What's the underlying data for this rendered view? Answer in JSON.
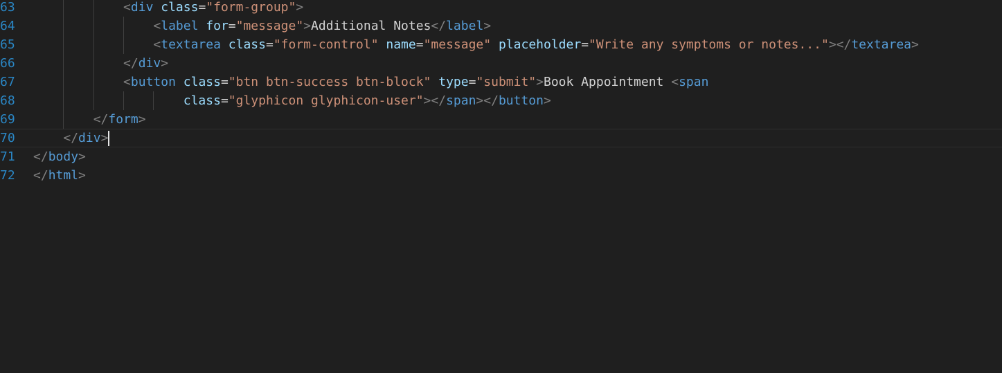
{
  "editor": {
    "colors": {
      "background": "#1f1f1f",
      "line_number": "#2a86c4",
      "punctuation": "#808080",
      "tag": "#569cd6",
      "attribute": "#9cdcfe",
      "string": "#ce9178",
      "text": "#d4d4d4"
    },
    "lines": [
      {
        "number": "63",
        "indent": "            ",
        "tokens": [
          {
            "type": "punct",
            "text": "<"
          },
          {
            "type": "tag",
            "text": "div"
          },
          {
            "type": "text",
            "text": " "
          },
          {
            "type": "attr",
            "text": "class"
          },
          {
            "type": "text",
            "text": "="
          },
          {
            "type": "str",
            "text": "\"form-group\""
          },
          {
            "type": "punct",
            "text": ">"
          }
        ]
      },
      {
        "number": "64",
        "indent": "                ",
        "tokens": [
          {
            "type": "punct",
            "text": "<"
          },
          {
            "type": "tag",
            "text": "label"
          },
          {
            "type": "text",
            "text": " "
          },
          {
            "type": "attr",
            "text": "for"
          },
          {
            "type": "text",
            "text": "="
          },
          {
            "type": "str",
            "text": "\"message\""
          },
          {
            "type": "punct",
            "text": ">"
          },
          {
            "type": "text",
            "text": "Additional Notes"
          },
          {
            "type": "punct",
            "text": "</"
          },
          {
            "type": "tag",
            "text": "label"
          },
          {
            "type": "punct",
            "text": ">"
          }
        ]
      },
      {
        "number": "65",
        "indent": "                ",
        "tokens": [
          {
            "type": "punct",
            "text": "<"
          },
          {
            "type": "tag",
            "text": "textarea"
          },
          {
            "type": "text",
            "text": " "
          },
          {
            "type": "attr",
            "text": "class"
          },
          {
            "type": "text",
            "text": "="
          },
          {
            "type": "str",
            "text": "\"form-control\""
          },
          {
            "type": "text",
            "text": " "
          },
          {
            "type": "attr",
            "text": "name"
          },
          {
            "type": "text",
            "text": "="
          },
          {
            "type": "str",
            "text": "\"message\""
          },
          {
            "type": "text",
            "text": " "
          },
          {
            "type": "attr",
            "text": "placeholder"
          },
          {
            "type": "text",
            "text": "="
          },
          {
            "type": "str",
            "text": "\"Write any symptoms or notes...\""
          },
          {
            "type": "punct",
            "text": "></"
          },
          {
            "type": "tag",
            "text": "textarea"
          },
          {
            "type": "punct",
            "text": ">"
          }
        ]
      },
      {
        "number": "66",
        "indent": "            ",
        "tokens": [
          {
            "type": "punct",
            "text": "</"
          },
          {
            "type": "tag",
            "text": "div"
          },
          {
            "type": "punct",
            "text": ">"
          }
        ]
      },
      {
        "number": "67",
        "indent": "            ",
        "tokens": [
          {
            "type": "punct",
            "text": "<"
          },
          {
            "type": "tag",
            "text": "button"
          },
          {
            "type": "text",
            "text": " "
          },
          {
            "type": "attr",
            "text": "class"
          },
          {
            "type": "text",
            "text": "="
          },
          {
            "type": "str",
            "text": "\"btn btn-success btn-block\""
          },
          {
            "type": "text",
            "text": " "
          },
          {
            "type": "attr",
            "text": "type"
          },
          {
            "type": "text",
            "text": "="
          },
          {
            "type": "str",
            "text": "\"submit\""
          },
          {
            "type": "punct",
            "text": ">"
          },
          {
            "type": "text",
            "text": "Book Appointment "
          },
          {
            "type": "punct",
            "text": "<"
          },
          {
            "type": "tag",
            "text": "span"
          }
        ]
      },
      {
        "number": "68",
        "indent": "                    ",
        "tokens": [
          {
            "type": "attr",
            "text": "class"
          },
          {
            "type": "text",
            "text": "="
          },
          {
            "type": "str",
            "text": "\"glyphicon glyphicon-user\""
          },
          {
            "type": "punct",
            "text": "></"
          },
          {
            "type": "tag",
            "text": "span"
          },
          {
            "type": "punct",
            "text": "></"
          },
          {
            "type": "tag",
            "text": "button"
          },
          {
            "type": "punct",
            "text": ">"
          }
        ]
      },
      {
        "number": "69",
        "indent": "        ",
        "tokens": [
          {
            "type": "punct",
            "text": "</"
          },
          {
            "type": "tag",
            "text": "form"
          },
          {
            "type": "punct",
            "text": ">"
          }
        ]
      },
      {
        "number": "70",
        "indent": "    ",
        "current": true,
        "tokens": [
          {
            "type": "punct",
            "text": "</"
          },
          {
            "type": "tag",
            "text": "div"
          },
          {
            "type": "punct",
            "text": ">"
          }
        ]
      },
      {
        "number": "71",
        "indent": "",
        "tokens": [
          {
            "type": "punct",
            "text": "</"
          },
          {
            "type": "tag",
            "text": "body"
          },
          {
            "type": "punct",
            "text": ">"
          }
        ]
      },
      {
        "number": "72",
        "indent": "",
        "tokens": [
          {
            "type": "punct",
            "text": "</"
          },
          {
            "type": "tag",
            "text": "html"
          },
          {
            "type": "punct",
            "text": ">"
          }
        ]
      }
    ]
  }
}
